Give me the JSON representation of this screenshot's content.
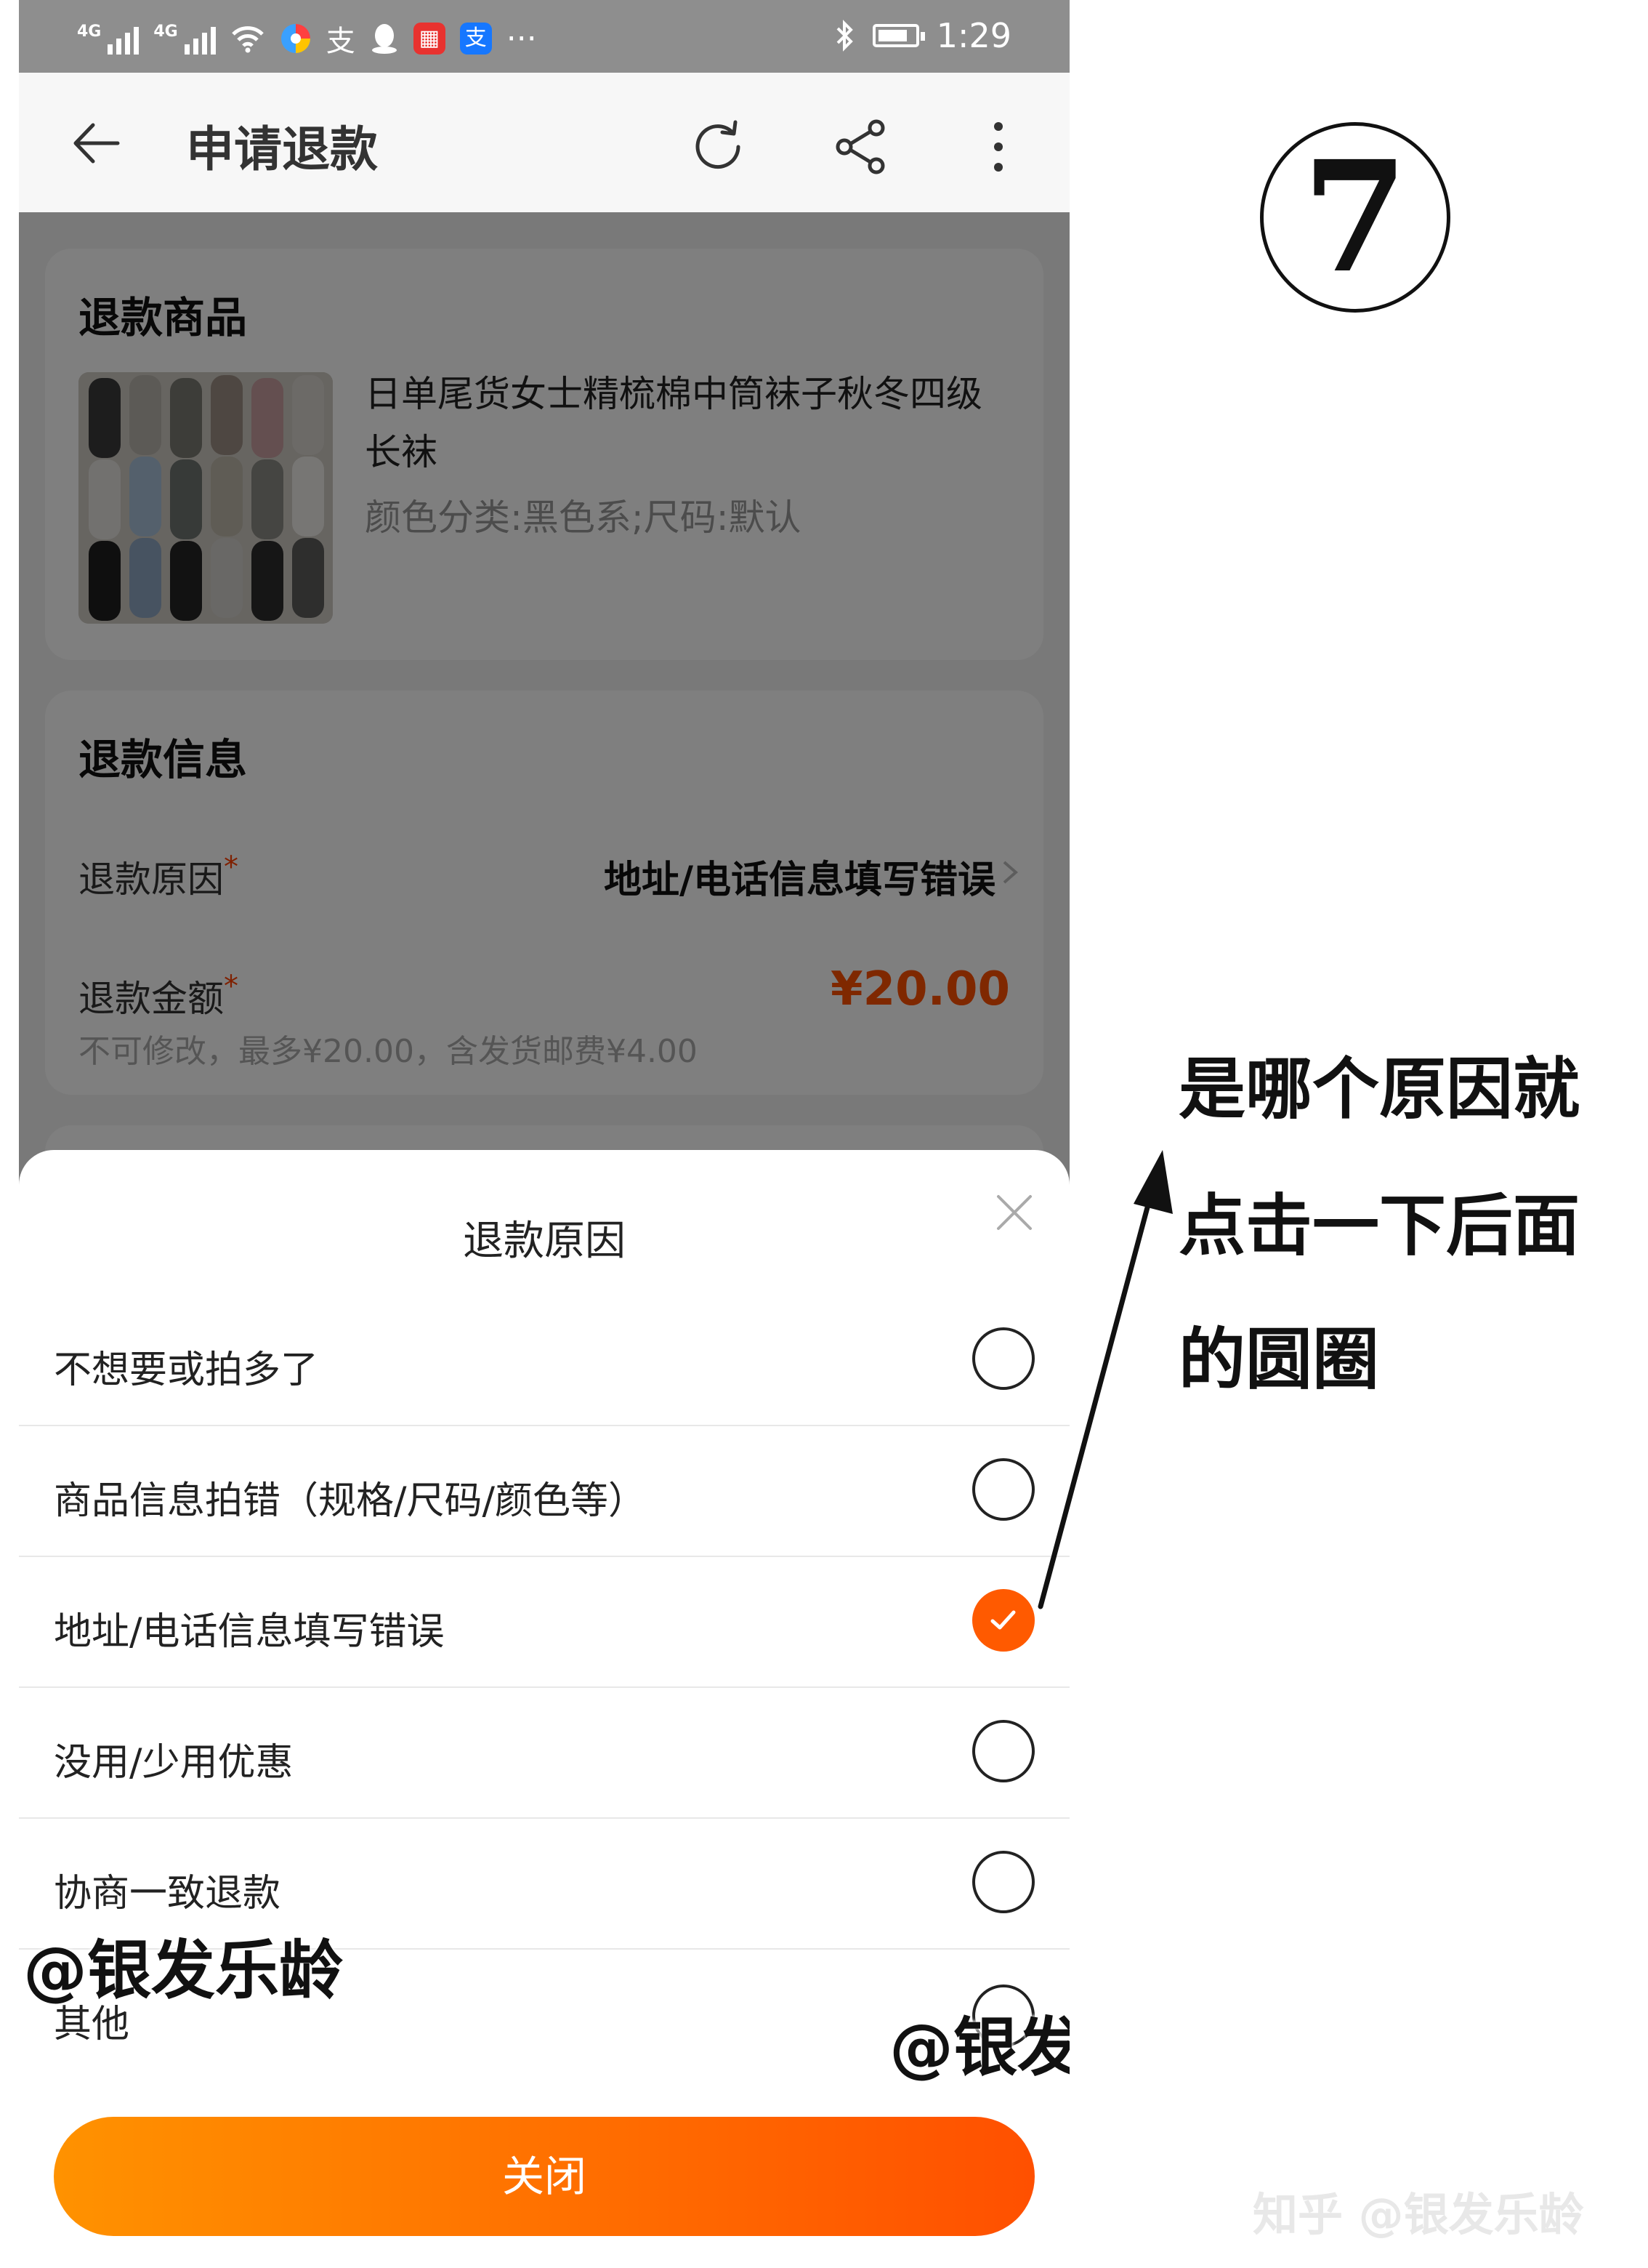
{
  "status_bar": {
    "network_1": "4G",
    "network_2": "4G",
    "app_icons": [
      "支",
      "支"
    ],
    "more": "···",
    "time": "1:29"
  },
  "nav": {
    "title": "申请退款"
  },
  "refund_item": {
    "section_title": "退款商品",
    "product_name": "日单尾货女士精梳棉中筒袜子秋冬四级长袜",
    "product_spec": "颜色分类:黑色系;尺码:默认"
  },
  "refund_info": {
    "section_title": "退款信息",
    "reason_label": "退款原因",
    "reason_value": "地址/电话信息填写错误",
    "amount_label": "退款金额",
    "amount_value": "¥20.00",
    "amount_hint": "不可修改，最多¥20.00，含发货邮费¥4.00",
    "required_mark": "*"
  },
  "sheet": {
    "title": "退款原因",
    "options": [
      {
        "label": "不想要或拍多了",
        "selected": false
      },
      {
        "label": "商品信息拍错（规格/尺码/颜色等）",
        "selected": false
      },
      {
        "label": "地址/电话信息填写错误",
        "selected": true
      },
      {
        "label": "没用/少用优惠",
        "selected": false
      },
      {
        "label": "协商一致退款",
        "selected": false
      },
      {
        "label": "其他",
        "selected": false
      }
    ],
    "close_label": "关闭"
  },
  "annotation": {
    "step_number": "7",
    "lines": [
      "是哪个原因就",
      "点击一下后面",
      "的圆圈"
    ],
    "watermark_1": "@银发乐龄",
    "watermark_2": "@银发乐龄",
    "zhihu_watermark": "知乎 @银发乐龄"
  },
  "colors": {
    "accent": "#ff5000",
    "button_gradient_start": "#ff9200",
    "button_gradient_end": "#ff5000"
  }
}
